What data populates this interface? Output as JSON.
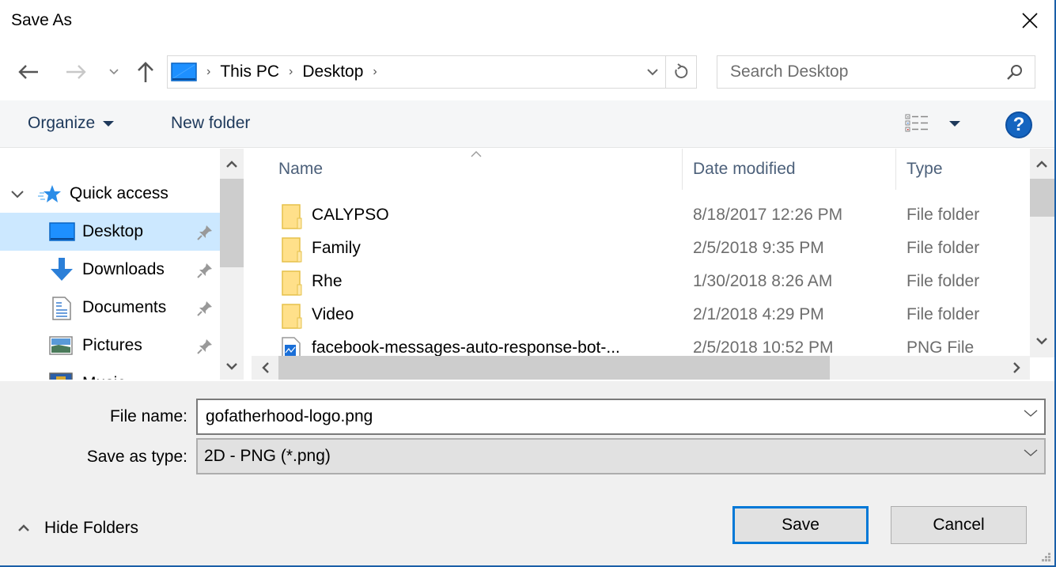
{
  "window": {
    "title": "Save As"
  },
  "nav": {
    "breadcrumb": [
      "This PC",
      "Desktop"
    ],
    "search_placeholder": "Search Desktop"
  },
  "toolbar": {
    "organize_label": "Organize",
    "new_folder_label": "New folder",
    "help_label": "?"
  },
  "nav_pane": {
    "group_label": "Quick access",
    "items": [
      {
        "label": "Desktop",
        "icon": "desktop-icon",
        "pinned": true,
        "selected": true
      },
      {
        "label": "Downloads",
        "icon": "downloads-icon",
        "pinned": true,
        "selected": false
      },
      {
        "label": "Documents",
        "icon": "documents-icon",
        "pinned": true,
        "selected": false
      },
      {
        "label": "Pictures",
        "icon": "pictures-icon",
        "pinned": true,
        "selected": false
      },
      {
        "label": "Music",
        "icon": "music-icon",
        "pinned": false,
        "selected": false
      }
    ]
  },
  "file_list": {
    "columns": [
      "Name",
      "Date modified",
      "Type"
    ],
    "rows": [
      {
        "name": "CALYPSO",
        "date": "8/18/2017 12:26 PM",
        "type": "File folder",
        "icon": "folder-icon"
      },
      {
        "name": "Family",
        "date": "2/5/2018 9:35 PM",
        "type": "File folder",
        "icon": "folder-icon"
      },
      {
        "name": "Rhe",
        "date": "1/30/2018 8:26 AM",
        "type": "File folder",
        "icon": "folder-icon"
      },
      {
        "name": "Video",
        "date": "2/1/2018 4:29 PM",
        "type": "File folder",
        "icon": "folder-icon"
      },
      {
        "name": "facebook-messages-auto-response-bot-...",
        "date": "2/5/2018 10:52 PM",
        "type": "PNG File",
        "icon": "png-file-icon"
      }
    ]
  },
  "form": {
    "file_name_label": "File name:",
    "file_name_value": "gofatherhood-logo.png",
    "save_type_label": "Save as type:",
    "save_type_value": "2D - PNG (*.png)"
  },
  "footer": {
    "hide_folders_label": "Hide Folders",
    "save_label": "Save",
    "cancel_label": "Cancel"
  },
  "colors": {
    "accent": "#0078d7",
    "selection": "#cce8ff",
    "folder": "#ffe08a",
    "help": "#1565c0"
  }
}
